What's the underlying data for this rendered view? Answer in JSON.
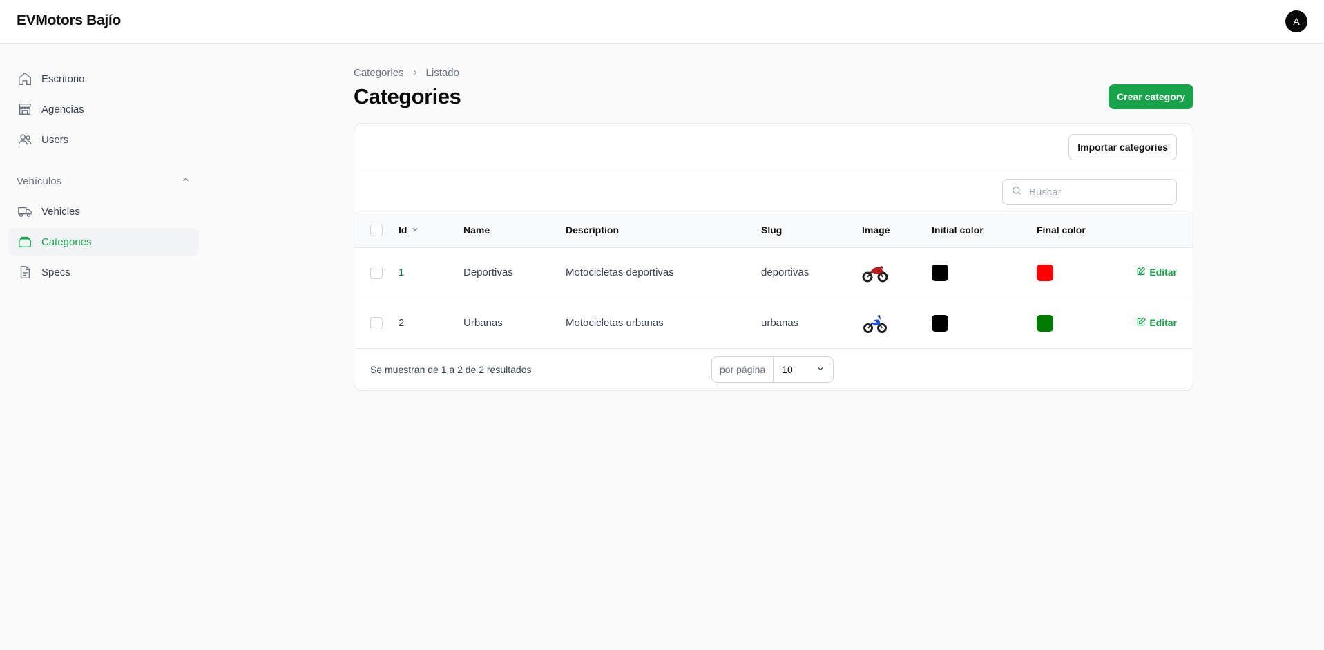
{
  "brand": {
    "name": "EVMotors Bajío"
  },
  "user": {
    "avatar_initial": "A"
  },
  "sidebar": {
    "items": [
      {
        "label": "Escritorio",
        "icon": "home-icon"
      },
      {
        "label": "Agencias",
        "icon": "storefront-icon"
      },
      {
        "label": "Users",
        "icon": "users-icon"
      }
    ],
    "group": {
      "label": "Vehículos",
      "items": [
        {
          "label": "Vehicles",
          "icon": "truck-icon"
        },
        {
          "label": "Categories",
          "icon": "layers-icon",
          "active": true
        },
        {
          "label": "Specs",
          "icon": "document-icon"
        }
      ]
    }
  },
  "breadcrumb": {
    "first": "Categories",
    "second": "Listado"
  },
  "page": {
    "title": "Categories",
    "create_button": "Crear category"
  },
  "toolbar": {
    "import_button": "Importar categories"
  },
  "search": {
    "placeholder": "Buscar"
  },
  "table": {
    "headers": {
      "id": "Id",
      "name": "Name",
      "description": "Description",
      "slug": "Slug",
      "image": "Image",
      "initial_color": "Initial color",
      "final_color": "Final color"
    },
    "edit_label": "Editar",
    "rows": [
      {
        "id": "1",
        "name": "Deportivas",
        "description": "Motocicletas deportivas",
        "slug": "deportivas",
        "image": "red-motorcycle",
        "initial_color": "#000000",
        "final_color": "#ff0000"
      },
      {
        "id": "2",
        "name": "Urbanas",
        "description": "Motocicletas urbanas",
        "slug": "urbanas",
        "image": "blue-motorcycle",
        "initial_color": "#000000",
        "final_color": "#007a00"
      }
    ]
  },
  "footer": {
    "results_text": "Se muestran de 1 a 2 de 2 resultados",
    "per_page_label": "por página",
    "per_page_value": "10"
  },
  "colors": {
    "accent": "#16a34a"
  }
}
